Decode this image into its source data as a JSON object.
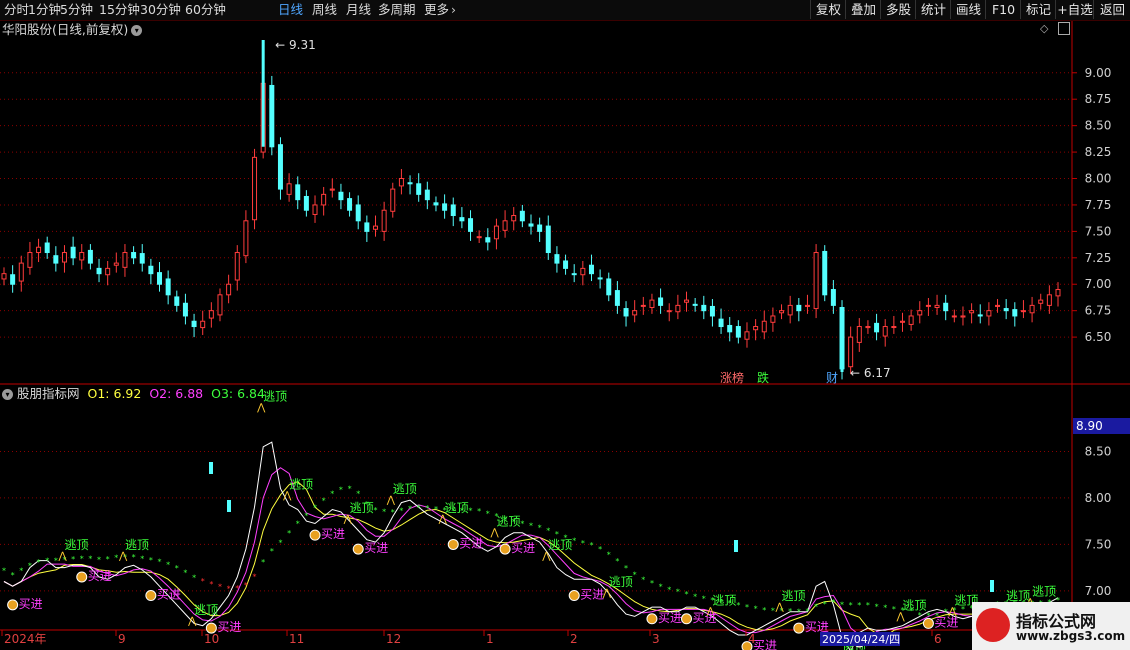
{
  "toolbar": {
    "periods": [
      "分时",
      "1分钟",
      "5分钟",
      "15分钟",
      "30分钟",
      "60分钟",
      "日线",
      "周线",
      "月线",
      "多周期",
      "更多"
    ],
    "active_period": "日线",
    "right_buttons": [
      "复权",
      "叠加",
      "多股",
      "统计",
      "画线",
      "F10",
      "标记",
      "+自选",
      "返回"
    ]
  },
  "stock": {
    "title": "华阳股份(日线,前复权)"
  },
  "indicator": {
    "name": "股朋指标网",
    "o1": "O1: 6.92",
    "o2": "O2: 6.88",
    "o3": "O3: 6.84"
  },
  "colors": {
    "up": "#ff3c3c",
    "down": "#54ffff",
    "grid": "#8a0000",
    "o1": "#ffffff",
    "o2": "#ff40ff",
    "o3": "#ffff40",
    "dots": "#3cff3c"
  },
  "price_axis": {
    "labels": [
      "9.00",
      "8.75",
      "8.50",
      "8.25",
      "8.00",
      "7.75",
      "7.50",
      "7.25",
      "7.00",
      "6.75",
      "6.50"
    ]
  },
  "ind_axis": {
    "labels": [
      "8.50",
      "8.00",
      "7.50",
      "7.00"
    ],
    "current": "8.90"
  },
  "annotations": {
    "high": "9.31",
    "low": "6.17",
    "tags": [
      "涨榜",
      "跌",
      "财"
    ]
  },
  "signals": {
    "sell": "逃顶",
    "buy": "买进"
  },
  "x_axis": {
    "labels": [
      "2024年",
      "9",
      "10",
      "11",
      "12",
      "1",
      "2",
      "3",
      "4",
      "6"
    ],
    "cursor_date": "2025/04/24/四"
  },
  "watermark": {
    "line1": "指标公式网",
    "line2": "www.zbgs3.com"
  },
  "chart_data": {
    "type": "candlestick",
    "price_range": [
      6.17,
      9.31
    ],
    "closes": [
      7.1,
      7.0,
      7.2,
      7.3,
      7.35,
      7.3,
      7.2,
      7.3,
      7.25,
      7.3,
      7.2,
      7.1,
      7.15,
      7.2,
      7.3,
      7.25,
      7.2,
      7.1,
      7.0,
      6.9,
      6.8,
      6.7,
      6.6,
      6.65,
      6.75,
      6.9,
      7.0,
      7.3,
      7.6,
      8.2,
      8.9,
      8.3,
      7.9,
      7.95,
      7.8,
      7.7,
      7.75,
      7.85,
      7.9,
      7.8,
      7.7,
      7.6,
      7.5,
      7.55,
      7.7,
      7.9,
      8.0,
      7.95,
      7.85,
      7.8,
      7.75,
      7.7,
      7.65,
      7.6,
      7.5,
      7.45,
      7.4,
      7.55,
      7.6,
      7.65,
      7.6,
      7.55,
      7.5,
      7.3,
      7.2,
      7.15,
      7.1,
      7.15,
      7.1,
      7.05,
      6.9,
      6.8,
      6.7,
      6.75,
      6.8,
      6.85,
      6.8,
      6.75,
      6.8,
      6.85,
      6.8,
      6.75,
      6.7,
      6.6,
      6.55,
      6.5,
      6.55,
      6.6,
      6.65,
      6.7,
      6.75,
      6.8,
      6.75,
      6.8,
      7.3,
      6.9,
      6.8,
      6.2,
      6.5,
      6.6,
      6.6,
      6.55,
      6.6,
      6.6,
      6.65,
      6.7,
      6.75,
      6.8,
      6.8,
      6.75,
      6.7,
      6.7,
      6.75,
      6.7,
      6.75,
      6.8,
      6.75,
      6.7,
      6.75,
      6.8,
      6.85,
      6.9,
      6.95
    ]
  }
}
